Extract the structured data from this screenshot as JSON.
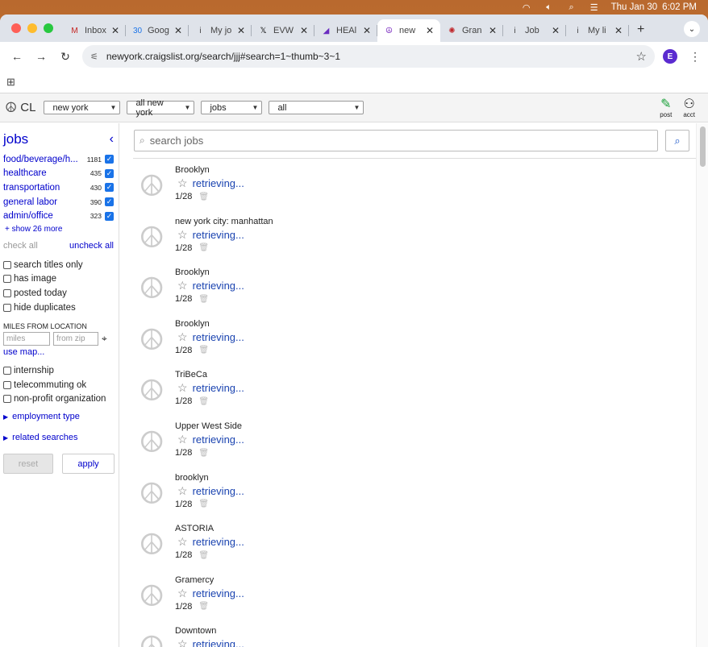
{
  "system": {
    "date": "Thu Jan 30",
    "time": "6:02 PM"
  },
  "tabs": [
    {
      "title": "Inbox",
      "icon": "gmail-icon",
      "glyph": "M",
      "color": "#c5221f",
      "active": false
    },
    {
      "title": "Goog",
      "icon": "calendar-icon",
      "glyph": "30",
      "color": "#1a73e8",
      "active": false
    },
    {
      "title": "My jo",
      "icon": "info-icon",
      "glyph": "i",
      "color": "#444",
      "active": false
    },
    {
      "title": "EVW",
      "icon": "x-icon",
      "glyph": "𝕏",
      "color": "#000",
      "active": false
    },
    {
      "title": "HEAl",
      "icon": "purple-arrow-icon",
      "glyph": "◢",
      "color": "#6a2cc0",
      "active": false
    },
    {
      "title": "new",
      "icon": "peace-icon",
      "glyph": "☮",
      "color": "#7b2cc0",
      "active": true
    },
    {
      "title": "Gran",
      "icon": "grant-icon",
      "glyph": "✺",
      "color": "#c0262b",
      "active": false
    },
    {
      "title": "Job",
      "icon": "info-icon",
      "glyph": "i",
      "color": "#444",
      "active": false
    },
    {
      "title": "My li",
      "icon": "info-icon",
      "glyph": "i",
      "color": "#444",
      "active": false
    }
  ],
  "browser": {
    "url": "newyork.craigslist.org/search/jjj#search=1~thumb~3~1",
    "profile_initial": "E"
  },
  "header": {
    "logo_text": "CL",
    "selects": [
      "new york",
      "all new york",
      "jobs",
      "all"
    ],
    "post_label": "post",
    "acct_label": "acct"
  },
  "sidebar": {
    "title": "jobs",
    "categories": [
      {
        "name": "food/beverage/h...",
        "count": "1181"
      },
      {
        "name": "healthcare",
        "count": "435"
      },
      {
        "name": "transportation",
        "count": "430"
      },
      {
        "name": "general labor",
        "count": "390"
      },
      {
        "name": "admin/office",
        "count": "323"
      }
    ],
    "show_more": "+ show 26 more",
    "check_all": "check all",
    "uncheck_all": "uncheck all",
    "options": [
      "search titles only",
      "has image",
      "posted today",
      "hide duplicates"
    ],
    "miles_label": "MILES FROM LOCATION",
    "miles_placeholder": "miles",
    "zip_placeholder": "from zip",
    "use_map": "use map...",
    "options2": [
      "internship",
      "telecommuting ok",
      "non-profit organization"
    ],
    "employment_type": "employment type",
    "related_searches": "related searches",
    "reset": "reset",
    "apply": "apply"
  },
  "search": {
    "placeholder": "search jobs"
  },
  "results": [
    {
      "location": "Brooklyn",
      "title": "retrieving...",
      "date": "1/28"
    },
    {
      "location": "new york city: manhattan",
      "title": "retrieving...",
      "date": "1/28"
    },
    {
      "location": "Brooklyn",
      "title": "retrieving...",
      "date": "1/28"
    },
    {
      "location": "Brooklyn",
      "title": "retrieving...",
      "date": "1/28"
    },
    {
      "location": "TriBeCa",
      "title": "retrieving...",
      "date": "1/28"
    },
    {
      "location": "Upper West Side",
      "title": "retrieving...",
      "date": "1/28"
    },
    {
      "location": "brooklyn",
      "title": "retrieving...",
      "date": "1/28"
    },
    {
      "location": "ASTORIA",
      "title": "retrieving...",
      "date": "1/28"
    },
    {
      "location": "Gramercy",
      "title": "retrieving...",
      "date": "1/28"
    },
    {
      "location": "Downtown",
      "title": "retrieving...",
      "date": ""
    }
  ]
}
